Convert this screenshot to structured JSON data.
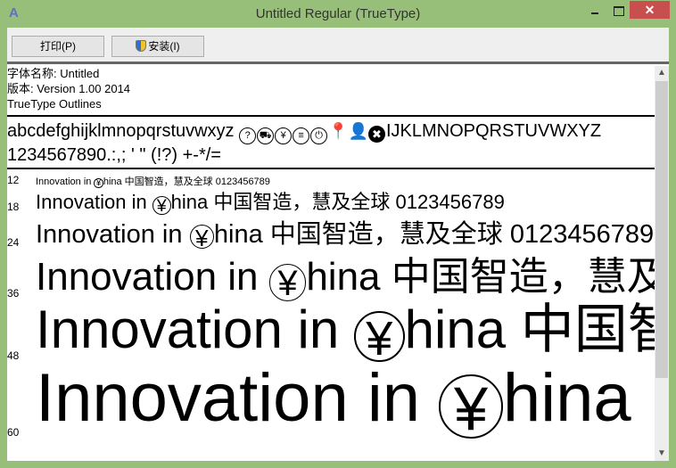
{
  "window": {
    "title": "Untitled Regular (TrueType)",
    "close": "✕"
  },
  "toolbar": {
    "print": "打印(P)",
    "install": "安装(I)"
  },
  "info": {
    "name": "字体名称: Untitled",
    "version": "版本: Version 1.00 2014",
    "outlines": "TrueType Outlines"
  },
  "alphabet": {
    "line1a": "abcdefghijklmnopqrstuvwxyz",
    "glyphs": [
      "?",
      "⛟",
      "¥",
      "≡",
      "⏻"
    ],
    "filled": [
      "⬤",
      "👤",
      "✖"
    ],
    "line1b": "IJKLMNOPQRSTUVWXYZ",
    "line2": "1234567890.:,; ' \" (!?) +-*/="
  },
  "samples": {
    "prefix": "Innovation in ",
    "yen": "¥",
    "suffix": "hina 中国智造，慧及全球 0123456789",
    "sizes": [
      "12",
      "18",
      "24",
      "36",
      "48",
      "60"
    ]
  }
}
